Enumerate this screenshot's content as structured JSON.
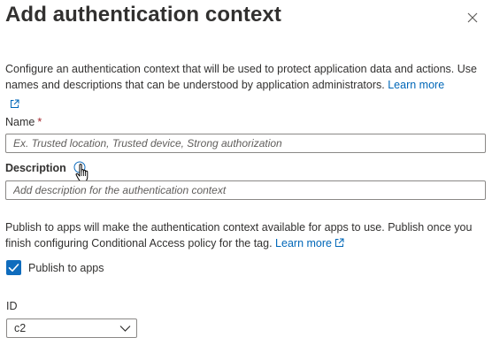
{
  "panel": {
    "title": "Add authentication context",
    "close_icon": "close-icon",
    "intro_text": "Configure an authentication context that will be used to protect application data and actions. Use names and descriptions that can be understood by application administrators.",
    "intro_link": "Learn more",
    "external_link_icon": "external-link-icon"
  },
  "name_field": {
    "label": "Name",
    "required_marker": "*",
    "placeholder": "Ex. Trusted location, Trusted device, Strong authorization",
    "value": ""
  },
  "description_field": {
    "label": "Description",
    "info_icon": "info-icon",
    "placeholder": "Add description for the authentication context",
    "value": ""
  },
  "publish": {
    "text": "Publish to apps will make the authentication context available for apps to use. Publish once you finish configuring Conditional Access policy for the tag.",
    "link": "Learn more",
    "checkbox_label": "Publish to apps",
    "checked": true
  },
  "id_field": {
    "label": "ID",
    "selected": "c2"
  },
  "colors": {
    "accent": "#0f6cbd",
    "link": "#0067b8",
    "required": "#a4262c",
    "border": "#8a8886",
    "text": "#323130"
  }
}
